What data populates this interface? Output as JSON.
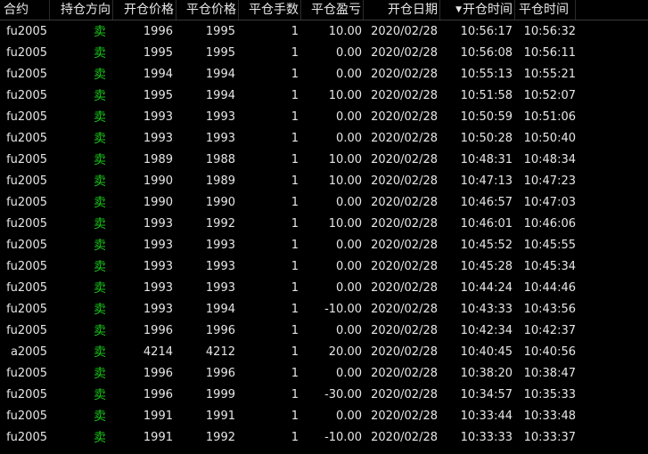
{
  "columns": {
    "contract": "合约",
    "direction": "持仓方向",
    "open_price": "开仓价格",
    "close_price": "平仓价格",
    "lots": "平仓手数",
    "profit_loss": "平仓盈亏",
    "open_date": "开仓日期",
    "open_time": "开仓时间",
    "close_time": "平仓时间"
  },
  "sort_icon": "triangle-down-icon",
  "colors": {
    "background": "#000000",
    "text": "#e6e6e6",
    "sell_green": "#18c618"
  },
  "rows": [
    {
      "contract": "fu2005",
      "direction": "卖",
      "open_price": "1996",
      "close_price": "1995",
      "lots": "1",
      "profit_loss": "10.00",
      "open_date": "2020/02/28",
      "open_time": "10:56:17",
      "close_time": "10:56:32"
    },
    {
      "contract": "fu2005",
      "direction": "卖",
      "open_price": "1995",
      "close_price": "1995",
      "lots": "1",
      "profit_loss": "0.00",
      "open_date": "2020/02/28",
      "open_time": "10:56:08",
      "close_time": "10:56:11"
    },
    {
      "contract": "fu2005",
      "direction": "卖",
      "open_price": "1994",
      "close_price": "1994",
      "lots": "1",
      "profit_loss": "0.00",
      "open_date": "2020/02/28",
      "open_time": "10:55:13",
      "close_time": "10:55:21"
    },
    {
      "contract": "fu2005",
      "direction": "卖",
      "open_price": "1995",
      "close_price": "1994",
      "lots": "1",
      "profit_loss": "10.00",
      "open_date": "2020/02/28",
      "open_time": "10:51:58",
      "close_time": "10:52:07"
    },
    {
      "contract": "fu2005",
      "direction": "卖",
      "open_price": "1993",
      "close_price": "1993",
      "lots": "1",
      "profit_loss": "0.00",
      "open_date": "2020/02/28",
      "open_time": "10:50:59",
      "close_time": "10:51:06"
    },
    {
      "contract": "fu2005",
      "direction": "卖",
      "open_price": "1993",
      "close_price": "1993",
      "lots": "1",
      "profit_loss": "0.00",
      "open_date": "2020/02/28",
      "open_time": "10:50:28",
      "close_time": "10:50:40"
    },
    {
      "contract": "fu2005",
      "direction": "卖",
      "open_price": "1989",
      "close_price": "1988",
      "lots": "1",
      "profit_loss": "10.00",
      "open_date": "2020/02/28",
      "open_time": "10:48:31",
      "close_time": "10:48:34"
    },
    {
      "contract": "fu2005",
      "direction": "卖",
      "open_price": "1990",
      "close_price": "1989",
      "lots": "1",
      "profit_loss": "10.00",
      "open_date": "2020/02/28",
      "open_time": "10:47:13",
      "close_time": "10:47:23"
    },
    {
      "contract": "fu2005",
      "direction": "卖",
      "open_price": "1990",
      "close_price": "1990",
      "lots": "1",
      "profit_loss": "0.00",
      "open_date": "2020/02/28",
      "open_time": "10:46:57",
      "close_time": "10:47:03"
    },
    {
      "contract": "fu2005",
      "direction": "卖",
      "open_price": "1993",
      "close_price": "1992",
      "lots": "1",
      "profit_loss": "10.00",
      "open_date": "2020/02/28",
      "open_time": "10:46:01",
      "close_time": "10:46:06"
    },
    {
      "contract": "fu2005",
      "direction": "卖",
      "open_price": "1993",
      "close_price": "1993",
      "lots": "1",
      "profit_loss": "0.00",
      "open_date": "2020/02/28",
      "open_time": "10:45:52",
      "close_time": "10:45:55"
    },
    {
      "contract": "fu2005",
      "direction": "卖",
      "open_price": "1993",
      "close_price": "1993",
      "lots": "1",
      "profit_loss": "0.00",
      "open_date": "2020/02/28",
      "open_time": "10:45:28",
      "close_time": "10:45:34"
    },
    {
      "contract": "fu2005",
      "direction": "卖",
      "open_price": "1993",
      "close_price": "1993",
      "lots": "1",
      "profit_loss": "0.00",
      "open_date": "2020/02/28",
      "open_time": "10:44:24",
      "close_time": "10:44:46"
    },
    {
      "contract": "fu2005",
      "direction": "卖",
      "open_price": "1993",
      "close_price": "1994",
      "lots": "1",
      "profit_loss": "-10.00",
      "open_date": "2020/02/28",
      "open_time": "10:43:33",
      "close_time": "10:43:56"
    },
    {
      "contract": "fu2005",
      "direction": "卖",
      "open_price": "1996",
      "close_price": "1996",
      "lots": "1",
      "profit_loss": "0.00",
      "open_date": "2020/02/28",
      "open_time": "10:42:34",
      "close_time": "10:42:37"
    },
    {
      "contract": "a2005",
      "direction": "卖",
      "open_price": "4214",
      "close_price": "4212",
      "lots": "1",
      "profit_loss": "20.00",
      "open_date": "2020/02/28",
      "open_time": "10:40:45",
      "close_time": "10:40:56"
    },
    {
      "contract": "fu2005",
      "direction": "卖",
      "open_price": "1996",
      "close_price": "1996",
      "lots": "1",
      "profit_loss": "0.00",
      "open_date": "2020/02/28",
      "open_time": "10:38:20",
      "close_time": "10:38:47"
    },
    {
      "contract": "fu2005",
      "direction": "卖",
      "open_price": "1996",
      "close_price": "1999",
      "lots": "1",
      "profit_loss": "-30.00",
      "open_date": "2020/02/28",
      "open_time": "10:34:57",
      "close_time": "10:35:33"
    },
    {
      "contract": "fu2005",
      "direction": "卖",
      "open_price": "1991",
      "close_price": "1991",
      "lots": "1",
      "profit_loss": "0.00",
      "open_date": "2020/02/28",
      "open_time": "10:33:44",
      "close_time": "10:33:48"
    },
    {
      "contract": "fu2005",
      "direction": "卖",
      "open_price": "1991",
      "close_price": "1992",
      "lots": "1",
      "profit_loss": "-10.00",
      "open_date": "2020/02/28",
      "open_time": "10:33:33",
      "close_time": "10:33:37"
    }
  ]
}
